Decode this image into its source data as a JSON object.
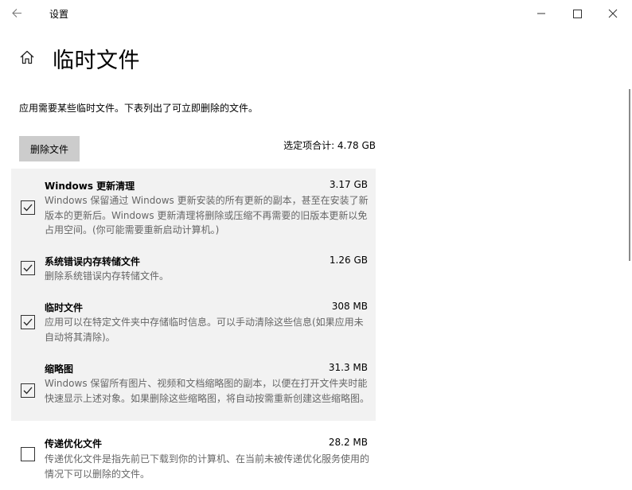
{
  "window": {
    "title": "设置"
  },
  "page": {
    "title": "临时文件",
    "description": "应用需要某些临时文件。下表列出了可立即删除的文件。"
  },
  "actions": {
    "delete_label": "删除文件",
    "total_label": "选定项合计: 4.78 GB"
  },
  "items": [
    {
      "name": "Windows 更新清理",
      "size": "3.17 GB",
      "checked": true,
      "description": "Windows 保留通过 Windows 更新安装的所有更新的副本，甚至在安装了新版本的更新后。Windows 更新清理将删除或压缩不再需要的旧版本更新以免占用空间。(你可能需要重新启动计算机。)"
    },
    {
      "name": "系统错误内存转储文件",
      "size": "1.26 GB",
      "checked": true,
      "description": "删除系统错误内存转储文件。"
    },
    {
      "name": "临时文件",
      "size": "308 MB",
      "checked": true,
      "description": "应用可以在特定文件夹中存储临时信息。可以手动清除这些信息(如果应用未自动将其清除)。"
    },
    {
      "name": "缩略图",
      "size": "31.3 MB",
      "checked": true,
      "description": "Windows 保留所有图片、视频和文档缩略图的副本，以便在打开文件夹时能快速显示上述对象。如果删除这些缩略图，将自动按需重新创建这些缩略图。"
    },
    {
      "name": "传递优化文件",
      "size": "28.2 MB",
      "checked": false,
      "description": "传递优化文件是指先前已下载到你的计算机、在当前未被传递优化服务使用的情况下可以删除的文件。"
    }
  ],
  "colors": {
    "selected_bg": "#f2f2f2",
    "button_bg": "#cccccc",
    "secondary_text": "#666666"
  },
  "icons": {
    "back": "back-arrow-icon",
    "home": "home-icon",
    "check": "checkmark-icon"
  }
}
